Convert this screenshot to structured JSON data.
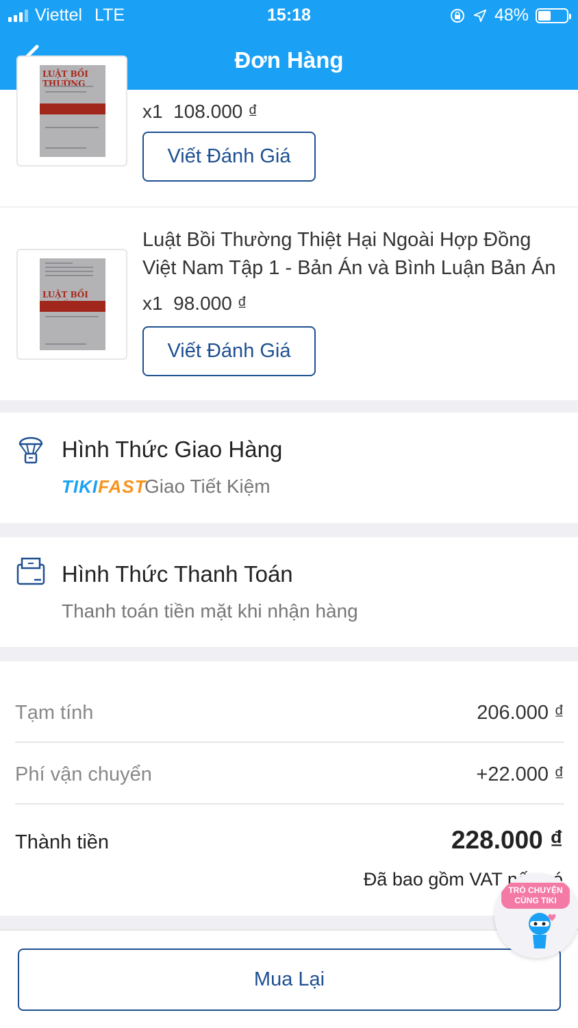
{
  "status_bar": {
    "carrier": "Viettel",
    "network": "LTE",
    "time": "15:18",
    "battery": "48%",
    "battery_level": 0.48
  },
  "header": {
    "title": "Đơn Hàng",
    "back_icon": "chevron-left-icon",
    "background": "#1aa1f5"
  },
  "items": [
    {
      "qty": "x1",
      "price": "108.000 ₫",
      "review_label": "Viết Đánh Giá",
      "cover_title": "LUẬT BỒI THƯỜNG"
    },
    {
      "title": "Luật Bồi Thường Thiệt Hại Ngoài Hợp Đồng Việt Nam Tập 1 - Bản Án và Bình Luận Bản Án",
      "qty": "x1",
      "price": "98.000 ₫",
      "review_label": "Viết Đánh Giá",
      "cover_title": "LUẬT BỒI THƯỜNG"
    }
  ],
  "shipping": {
    "title": "Hình Thức Giao Hàng",
    "brand_tiki": "TIKI",
    "brand_fast": "FAST",
    "method": "Giao Tiết Kiệm",
    "icon": "parachute-box-icon"
  },
  "payment": {
    "title": "Hình Thức Thanh Toán",
    "method": "Thanh toán tiền mặt khi nhận hàng",
    "icon": "cash-icon"
  },
  "summary": {
    "subtotal_label": "Tạm tính",
    "subtotal": "206.000 ₫",
    "shipping_label": "Phí vận chuyển",
    "shipping_fee": "+22.000 ₫",
    "total_label": "Thành tiền",
    "total": "228.000 ₫",
    "vat_note": "Đã bao gồm VAT nếu có"
  },
  "actions": {
    "rebuy_label": "Mua Lại"
  },
  "chat": {
    "line1": "TRÒ CHUYỆN",
    "line2": "CÙNG TIKI"
  },
  "colors": {
    "accent": "#1aa1f5",
    "button": "#1d4f91",
    "tiki_blue": "#1aa1f5",
    "fast_orange": "#f7941d"
  }
}
